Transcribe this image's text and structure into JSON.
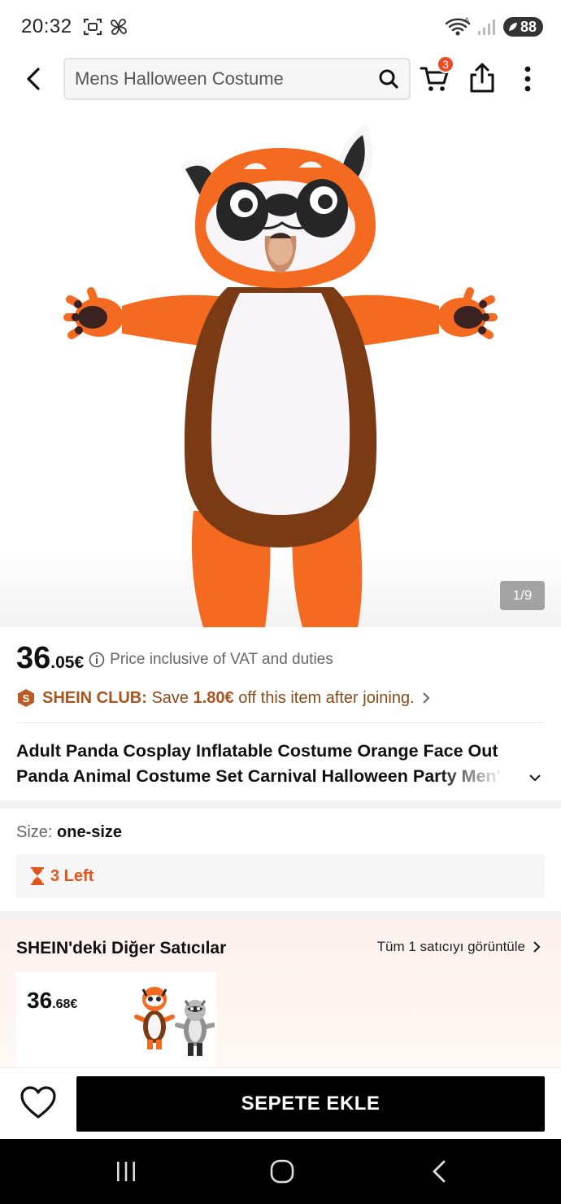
{
  "status_bar": {
    "time": "20:32",
    "wifi_label": "6",
    "battery": "88"
  },
  "header": {
    "search_text": "Mens Halloween Costume",
    "cart_count": "3"
  },
  "gallery": {
    "counter": "1/9",
    "colors": {
      "orange": "#f46a20",
      "brown": "#7a3a14",
      "white": "#f7f5f8",
      "black": "#262626"
    }
  },
  "price": {
    "integer": "36",
    "decimal": ".05€",
    "note": "Price inclusive of VAT and duties"
  },
  "club": {
    "badge": "S",
    "name": "SHEIN CLUB:",
    "text_before": "Save",
    "amount": "1.80€",
    "text_after": "off this item after joining."
  },
  "product": {
    "title": "Adult Panda Cosplay Inflatable Costume Orange Face Out Panda Animal Costume Set Carnival Halloween Party Men's ..."
  },
  "size": {
    "label": "Size:",
    "value": "one-size"
  },
  "stock": {
    "text": "3 Left"
  },
  "sellers": {
    "title": "SHEIN'deki Diğer Satıcılar",
    "link": "Tüm 1 satıcıyı görüntüle",
    "card_price_int": "36",
    "card_price_dec": ".68€"
  },
  "bottom": {
    "add_to_cart": "SEPETE EKLE"
  },
  "colors": {
    "accent_orange": "#e2531e",
    "club_brown": "#a8551f",
    "badge_red": "#ee4a24"
  }
}
